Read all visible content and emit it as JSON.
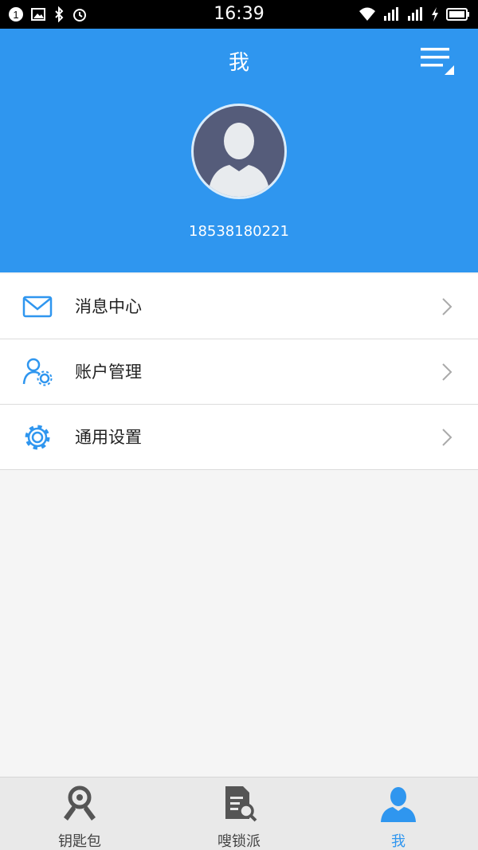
{
  "status_bar": {
    "time": "16:39",
    "left_icons": [
      "notification-badge-icon",
      "image-icon",
      "bluetooth-icon",
      "alarm-icon"
    ],
    "notification_count": "1",
    "right_icons": [
      "wifi-icon",
      "signal-icon",
      "signal-icon",
      "charging-icon",
      "battery-icon"
    ]
  },
  "header": {
    "title": "我",
    "menu_icon": "menu-icon",
    "phone": "18538180221",
    "color": "#2f96ef"
  },
  "menu": {
    "items": [
      {
        "label": "消息中心",
        "icon": "mail-icon"
      },
      {
        "label": "账户管理",
        "icon": "user-settings-icon"
      },
      {
        "label": "通用设置",
        "icon": "gear-icon"
      }
    ]
  },
  "tabbar": {
    "tabs": [
      {
        "label": "钥匙包",
        "icon": "keys-icon",
        "active": false
      },
      {
        "label": "嗖锁派",
        "icon": "document-search-icon",
        "active": false
      },
      {
        "label": "我",
        "icon": "user-icon",
        "active": true
      }
    ],
    "active_color": "#2f96ef"
  }
}
